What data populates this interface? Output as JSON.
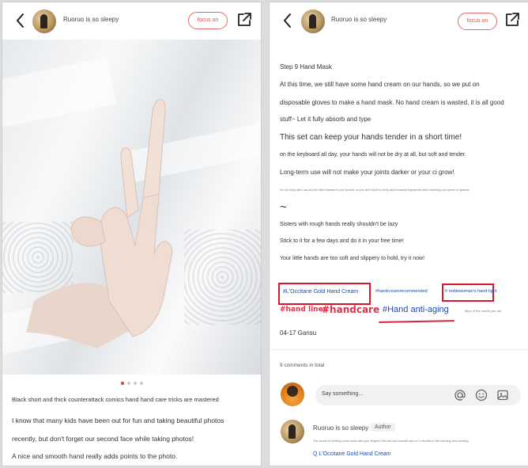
{
  "left": {
    "username": "Ruoruo is so sleepy",
    "focus_label": "focus on",
    "caption": "Black short and thick counterattack comics hand hand care tricks are mastered",
    "paragraph_lines": [
      "I know that many kids have been out for fun and taking beautiful photos",
      "recently, but don't forget our second face while taking photos!",
      "A nice and smooth hand really adds points to the photo."
    ],
    "carousel": {
      "count": 4,
      "active_index": 0
    }
  },
  "right": {
    "username": "Ruoruo is so sleepy",
    "focus_label": "focus on",
    "lines": [
      "Step 9 Hand Mask",
      "At this time, we still have some hand cream on our hands, so we put on",
      "disposable gloves to make a hand mask. No hand cream is wasted, it is all good",
      "stuff~ Let it fully absorb and type",
      "This set can keep your hands tender in a short time!",
      "on the keyboard all day, your hands will not be dry at all, but soft and tender.",
      "Long-term use will not make your joints darker or your ci grow!",
      "It's not clicky after use and the fitted handset is one second, so you don't have to worry about leaving fingerprints when touching your phone or glasses",
      "~",
      "Sisters with rough hands really shouldn't be lazy",
      "Stick to it for a few days and do it in your free time!",
      "Your little hands are too soft and slippery to hold, try it now!"
    ],
    "tags": {
      "occitane": "#L'Occitane Gold Hand Cream",
      "recommended": "#handcreamrecommended",
      "noblewoman": "# noblewoman's hand-light",
      "hand_lines": "#hand lines",
      "handcare": "#handcare",
      "anti_aging": "#Hand anti-aging",
      "small": "#tips of the month you are"
    },
    "date_location": "04-17 Gansu",
    "comments_total": "9 comments in total",
    "comment_placeholder": "Say something...",
    "comment": {
      "author": "Ruoruo is so sleepy",
      "badge": "Author",
      "text": "The secret of peeling onion roots with your fingers! Get soft and smooth skin in 2 minutes in the morning and evening",
      "link": "Q L'Occitane Gold Hand Cream"
    }
  },
  "colors": {
    "accent_red": "#e05050",
    "tag_blue": "#1f4aa8",
    "highlight_red": "#d8162a"
  }
}
